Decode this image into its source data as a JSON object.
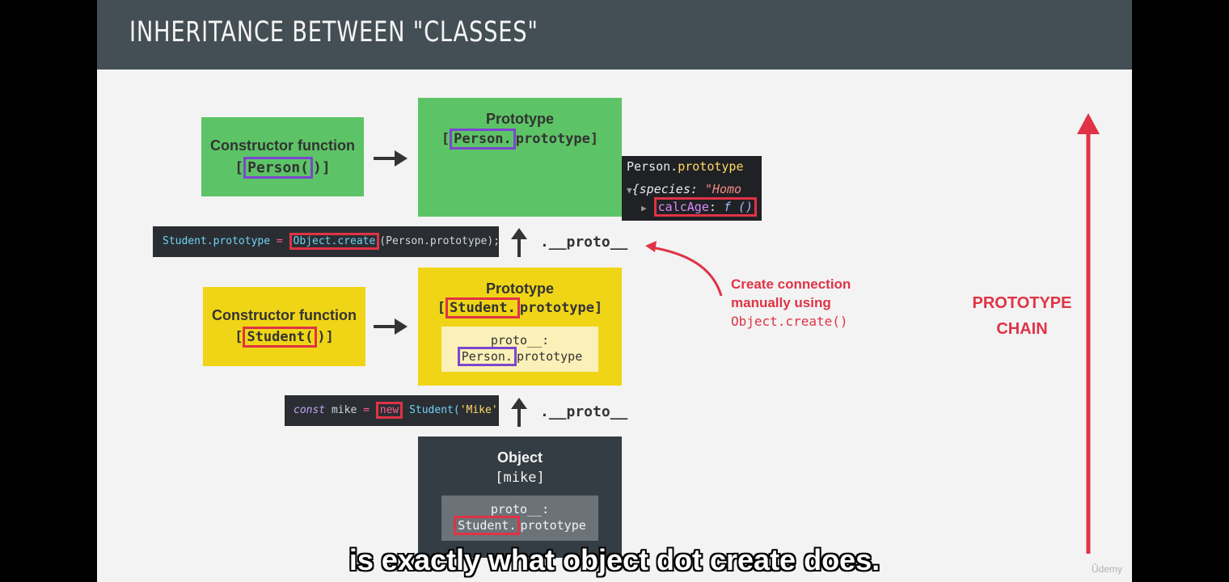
{
  "title": "INHERITANCE BETWEEN \"CLASSES\"",
  "person": {
    "ctor_heading": "Constructor function",
    "ctor_name": "[Person()]",
    "ctor_hl": "Person(",
    "ctor_rest": ")]",
    "proto_heading": "Prototype",
    "proto_hl": "Person.",
    "proto_rest": "prototype]"
  },
  "console": {
    "line1_obj": "Person.",
    "line1_prop": "prototype",
    "line2_key": "species",
    "line2_val": "\"Homo",
    "line3_key": "calcAge",
    "line3_val": "f ()"
  },
  "code1": {
    "part1": "Student.prototype",
    "eq": " = ",
    "hl": "Object.create",
    "part2": "(Person.prototype);"
  },
  "proto_label_1": ".__proto__",
  "proto_label_2": ".__proto__",
  "annotation": {
    "line1": "Create connection",
    "line2": "manually using",
    "line3": "Object.create()"
  },
  "student": {
    "ctor_heading": "Constructor function",
    "ctor_hl": "Student(",
    "ctor_rest": ")]",
    "proto_heading": "Prototype",
    "proto_hl": "Student.",
    "proto_rest": "prototype]",
    "inner_line1": "proto__:",
    "inner_hl": "Person.",
    "inner_rest": "prototype"
  },
  "code2": {
    "kw": "const",
    "var": " mike ",
    "eq": "= ",
    "new": "new",
    "cls": " Student(",
    "arg": "'Mike'",
    "tail": ","
  },
  "mike": {
    "heading": "Object",
    "name": "[mike]",
    "inner_line1": "proto__:",
    "inner_hl": "Student.",
    "inner_rest": "prototype"
  },
  "chain": {
    "line1": "PROTOTYPE",
    "line2": "CHAIN"
  },
  "watermark": "Ûdemy",
  "caption": "is exactly what object dot create does.",
  "colors": {
    "header": "#444e55",
    "green": "#5cc466",
    "yellow": "#f0d516",
    "dark": "#343d43",
    "purple": "#7c46d0",
    "red": "#e03345"
  }
}
